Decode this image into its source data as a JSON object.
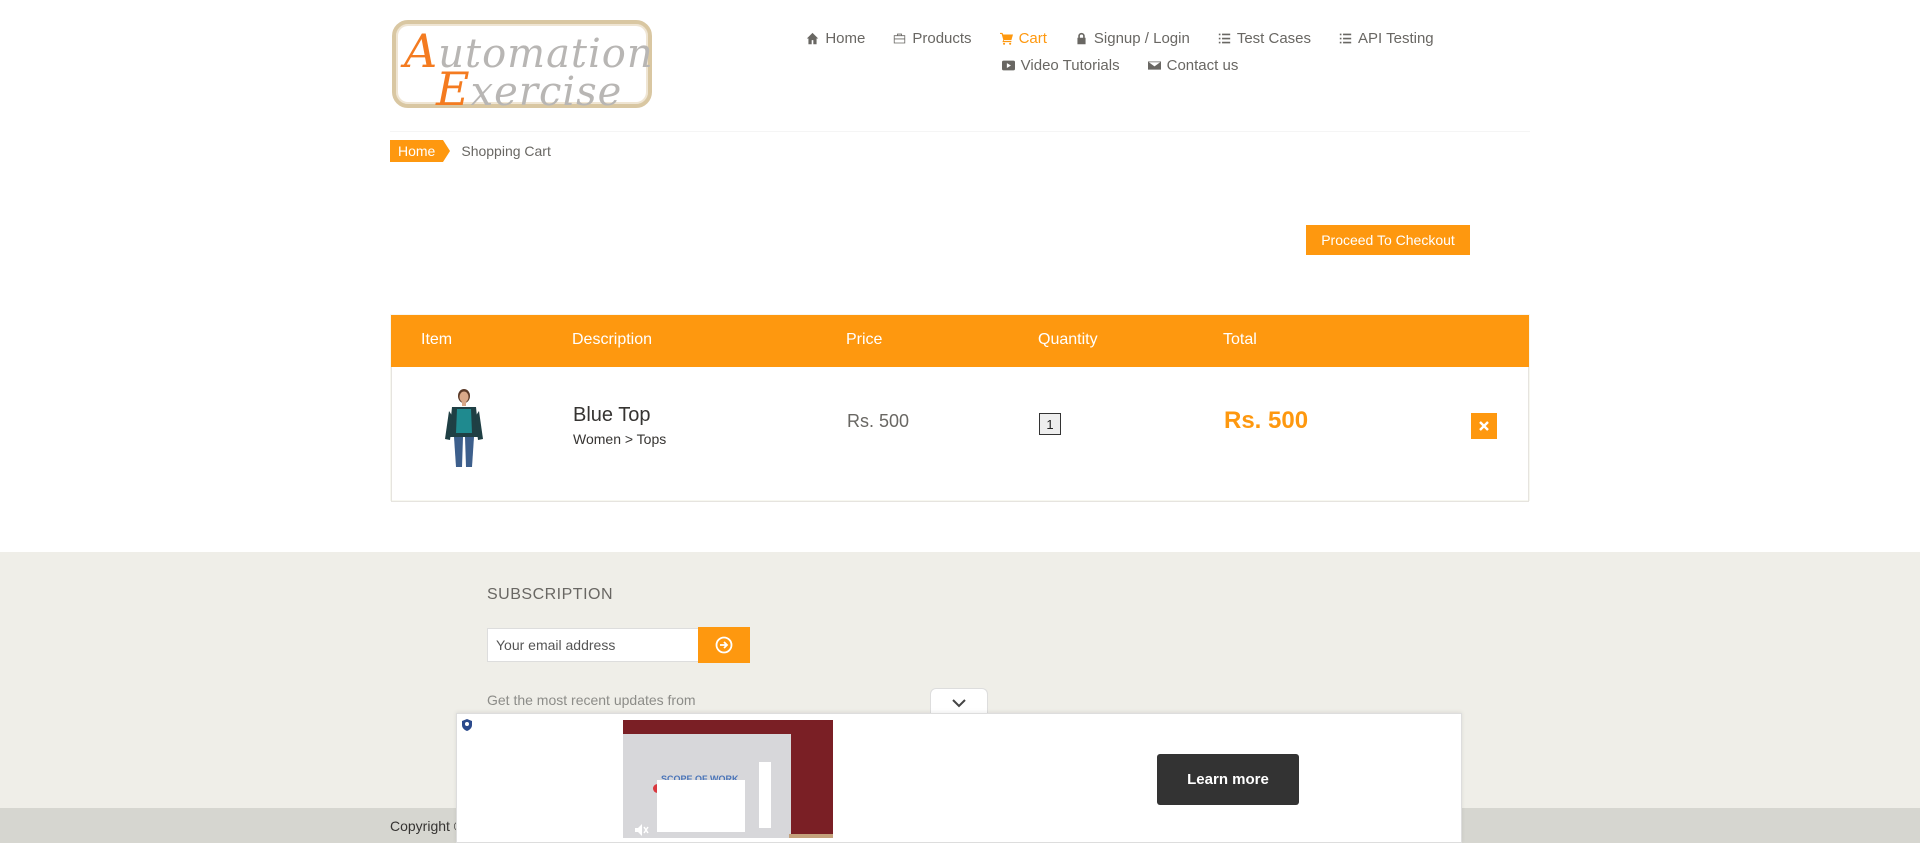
{
  "brand": {
    "logo_line1_cap": "A",
    "logo_line1_rest": "utomation",
    "logo_line2_cap": "E",
    "logo_line2_rest": "xercise",
    "accent_color": "#fe980f"
  },
  "nav": {
    "items": [
      {
        "label": "Home",
        "icon": "home-icon"
      },
      {
        "label": "Products",
        "icon": "briefcase-icon"
      },
      {
        "label": "Cart",
        "icon": "shopping-cart-icon",
        "active": true
      },
      {
        "label": "Signup / Login",
        "icon": "lock-icon"
      },
      {
        "label": "Test Cases",
        "icon": "list-icon"
      },
      {
        "label": "API Testing",
        "icon": "list-icon"
      },
      {
        "label": "Video Tutorials",
        "icon": "youtube-play-icon"
      },
      {
        "label": "Contact us",
        "icon": "envelope-icon"
      }
    ]
  },
  "breadcrumb": {
    "home": "Home",
    "current": "Shopping Cart"
  },
  "checkout": {
    "label": "Proceed To Checkout"
  },
  "cart": {
    "headers": {
      "item": "Item",
      "description": "Description",
      "price": "Price",
      "quantity": "Quantity",
      "total": "Total"
    },
    "rows": [
      {
        "name": "Blue Top",
        "category": "Women > Tops",
        "price": "Rs. 500",
        "quantity": "1",
        "total": "Rs. 500",
        "delete_icon": "close-icon"
      }
    ]
  },
  "footer": {
    "subscription_title": "SUBSCRIPTION",
    "email_placeholder": "Your email address",
    "subscribe_icon": "arrow-circle-right-icon",
    "subscription_text": "Get the most recent updates from",
    "copyright": "Copyright ©"
  },
  "ad": {
    "image_title": "SCOPE OF WORK",
    "learn_more": "Learn more",
    "collapse_icon": "chevron-down-icon"
  }
}
